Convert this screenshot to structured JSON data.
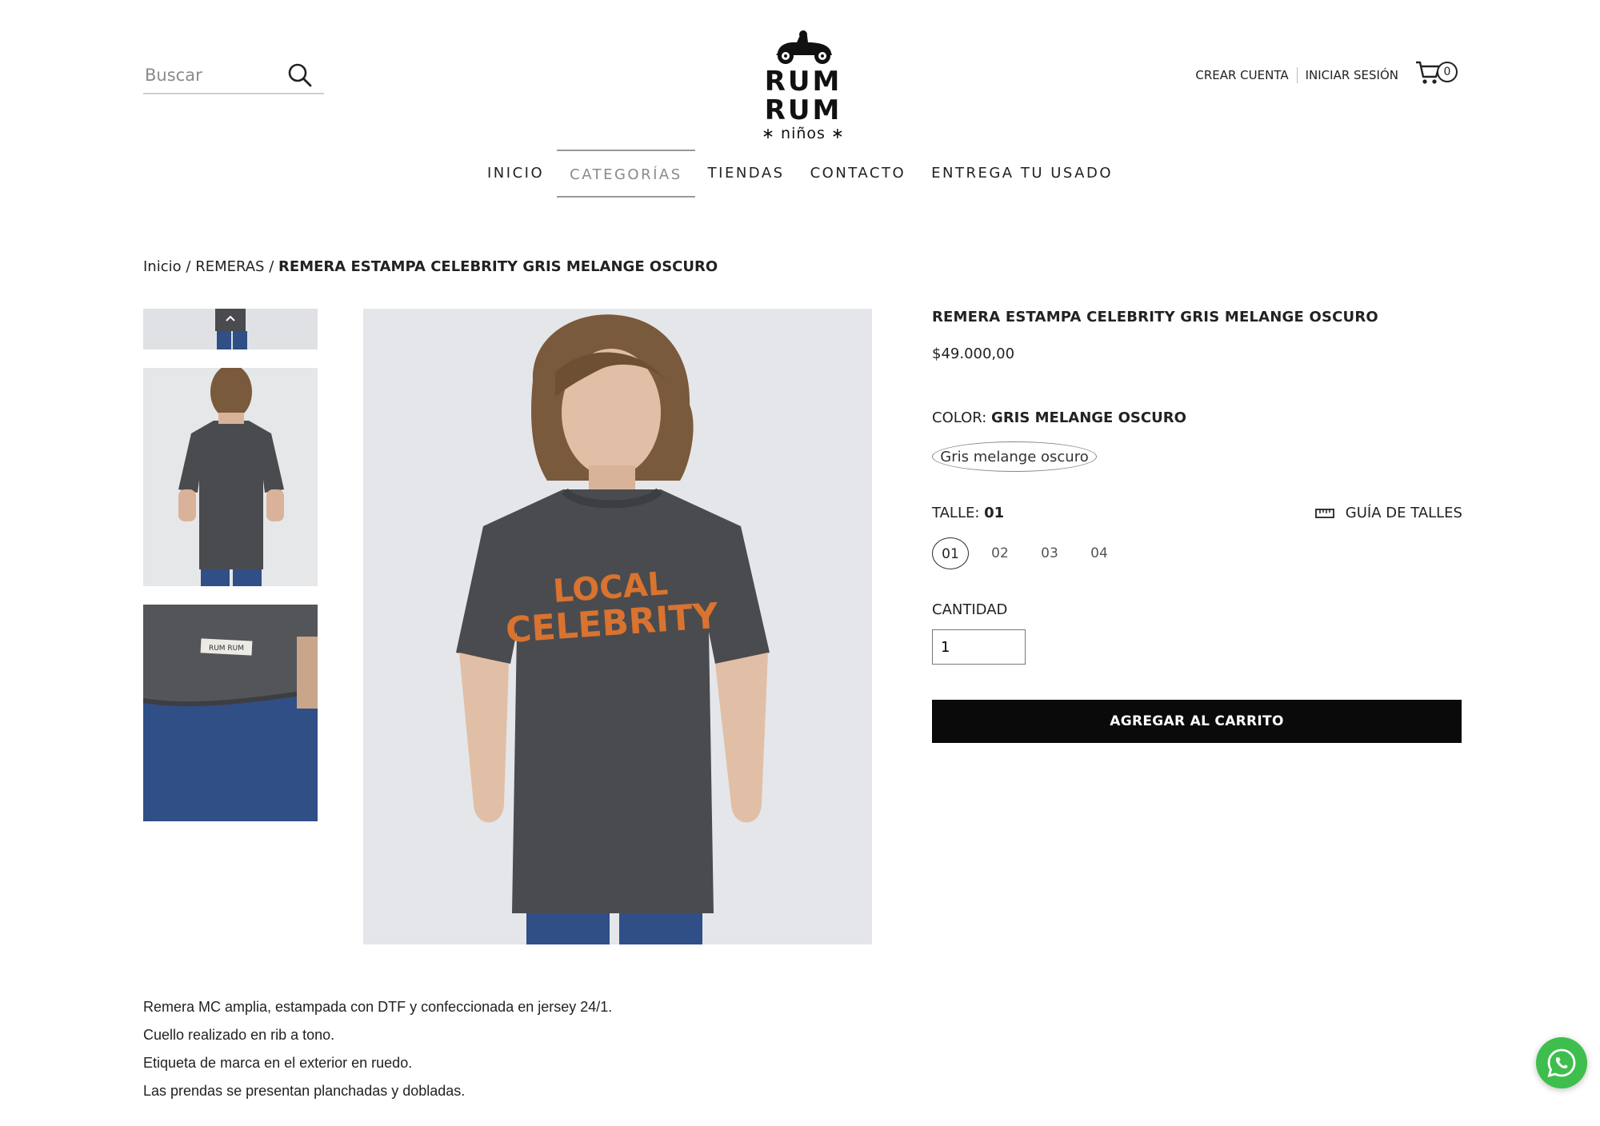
{
  "header": {
    "search_placeholder": "Buscar",
    "logo_text": "RUM RUM",
    "logo_sub": "∗ niños ∗",
    "create_account": "CREAR CUENTA",
    "login": "INICIAR SESIÓN",
    "cart_count": "0"
  },
  "nav": {
    "items": [
      {
        "label": "INICIO"
      },
      {
        "label": "CATEGORÍAS"
      },
      {
        "label": "TIENDAS"
      },
      {
        "label": "CONTACTO"
      },
      {
        "label": "ENTREGA TU USADO"
      }
    ]
  },
  "breadcrumb": {
    "home": "Inicio",
    "sep": "/",
    "category": "REMERAS",
    "current": "REMERA ESTAMPA CELEBRITY GRIS MELANGE OSCURO"
  },
  "product": {
    "title": "REMERA ESTAMPA CELEBRITY GRIS MELANGE OSCURO",
    "price": "$49.000,00",
    "color_label": "COLOR:",
    "color_value": "GRIS MELANGE OSCURO",
    "color_option": "Gris melange oscuro",
    "size_label": "TALLE:",
    "size_value": "01",
    "size_guide": "GUÍA DE TALLES",
    "sizes": [
      "01",
      "02",
      "03",
      "04"
    ],
    "qty_label": "CANTIDAD",
    "qty_value": "1",
    "add_to_cart": "AGREGAR AL CARRITO",
    "print_text_1": "LOCAL",
    "print_text_2": "CELEBRITY",
    "label_tag": "RUM RUM"
  },
  "description": [
    "Remera MC amplia, estampada con DTF y confeccionada en jersey 24/1.",
    "Cuello realizado en rib a tono.",
    "Etiqueta de marca en el exterior en ruedo.",
    "Las prendas se presentan planchadas y dobladas."
  ],
  "colors": {
    "tshirt": "#4a4b4e",
    "print": "#d9732f",
    "jeans": "#2f4f86",
    "bg": "#e4e6e9",
    "whatsapp": "#3dbe4d"
  }
}
